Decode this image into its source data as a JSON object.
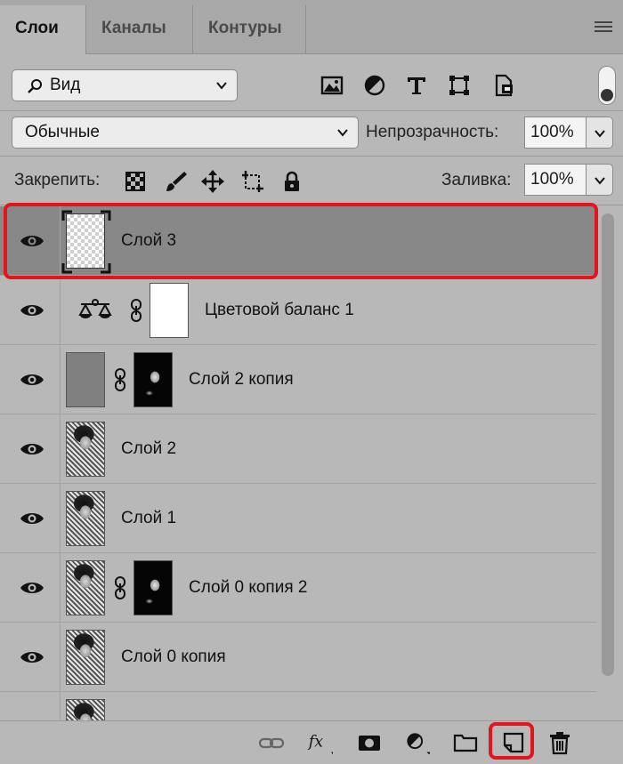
{
  "tabs": [
    {
      "label": "Слои"
    },
    {
      "label": "Каналы"
    },
    {
      "label": "Контуры"
    }
  ],
  "filter": {
    "label": "Вид",
    "icon": "search-icon"
  },
  "filter_icons": [
    "image-filter-icon",
    "adjustment-filter-icon",
    "type-filter-icon",
    "shape-filter-icon",
    "smart-object-filter-icon"
  ],
  "blend": {
    "mode": "Обычные",
    "opacity_label": "Непрозрачность:",
    "opacity_value": "100%"
  },
  "lock": {
    "label": "Закрепить:",
    "fill_label": "Заливка:",
    "fill_value": "100%"
  },
  "layers": [
    {
      "name": "Слой 3",
      "selected": true
    },
    {
      "name": "Цветовой баланс 1",
      "selected": false
    },
    {
      "name": "Слой 2 копия",
      "selected": false
    },
    {
      "name": "Слой 2",
      "selected": false
    },
    {
      "name": "Слой 1",
      "selected": false
    },
    {
      "name": "Слой 0 копия 2",
      "selected": false
    },
    {
      "name": "Слой 0 копия",
      "selected": false
    }
  ],
  "bottom_icons": [
    "link-icon",
    "fx-icon",
    "mask-icon",
    "adjustment-icon",
    "folder-icon",
    "new-layer-icon",
    "trash-icon"
  ],
  "colors": {
    "panel": "#b8b8b8",
    "selected_row": "#888888",
    "highlight": "#e3141b"
  }
}
